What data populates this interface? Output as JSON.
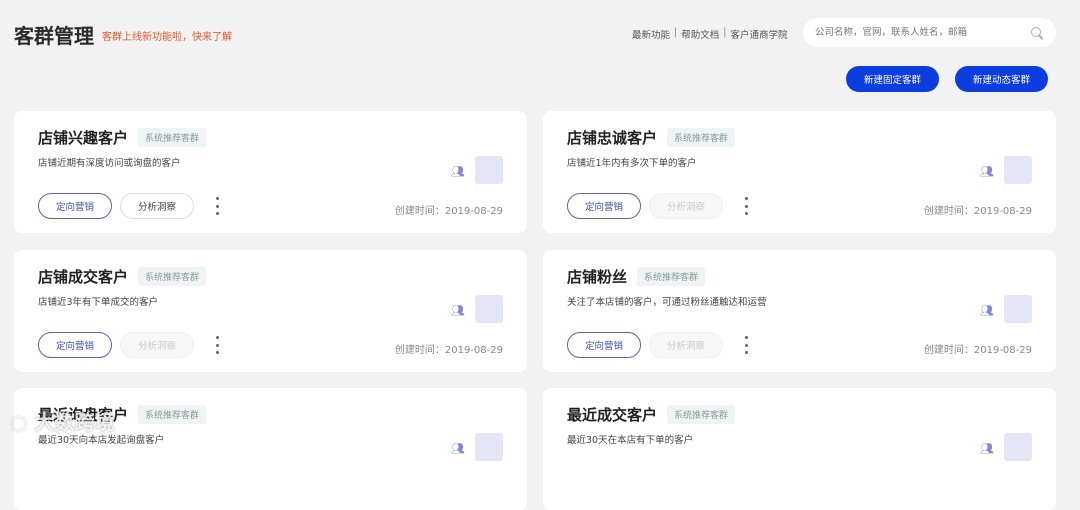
{
  "header": {
    "title": "客群管理",
    "notice": "客群上线新功能啦，快来了解",
    "links": [
      "最新功能",
      "帮助文档",
      "客户通商学院"
    ],
    "search_placeholder": "公司名称，官网，联系人姓名，邮箱",
    "new_fixed": "新建固定客群",
    "new_dynamic": "新建动态客群"
  },
  "cards": [
    {
      "name": "店铺兴趣客户",
      "tag": "系统推荐客群",
      "desc": "店铺近期有深度访问或询盘的客户",
      "btn1": "定向营销",
      "btn2": "分析洞察",
      "btn2_enabled": true,
      "date": "创建时间：2019-08-29"
    },
    {
      "name": "店铺忠诚客户",
      "tag": "系统推荐客群",
      "desc": "店铺近1年内有多次下单的客户",
      "btn1": "定向营销",
      "btn2": "分析洞察",
      "btn2_enabled": false,
      "date": "创建时间：2019-08-29"
    },
    {
      "name": "店铺成交客户",
      "tag": "系统推荐客群",
      "desc": "店铺近3年有下单成交的客户",
      "btn1": "定向营销",
      "btn2": "分析洞察",
      "btn2_enabled": false,
      "date": "创建时间：2019-08-29"
    },
    {
      "name": "店铺粉丝",
      "tag": "系统推荐客群",
      "desc": "关注了本店铺的客户，可通过粉丝通触达和运营",
      "btn1": "定向营销",
      "btn2": "分析洞察",
      "btn2_enabled": false,
      "date": "创建时间：2019-08-29"
    },
    {
      "name": "最近询盘客户",
      "tag": "系统推荐客群",
      "desc": "最近30天向本店发起询盘客户"
    },
    {
      "name": "最近成交客户",
      "tag": "系统推荐客群",
      "desc": "最近30天在本店有下单的客户"
    }
  ],
  "watermark": "大数跨境"
}
